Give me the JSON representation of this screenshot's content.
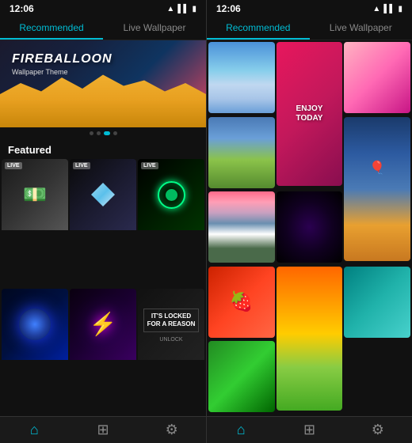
{
  "screens": [
    {
      "id": "left",
      "statusBar": {
        "time": "12:06",
        "icons": [
          "wifi",
          "signal",
          "battery"
        ]
      },
      "tabs": [
        {
          "id": "recommended",
          "label": "Recommended",
          "active": true
        },
        {
          "id": "live",
          "label": "Live Wallpaper",
          "active": false
        }
      ],
      "hero": {
        "title": "FIREBALLOON",
        "subtitle": "Wallpaper Theme"
      },
      "dots": [
        {
          "active": false
        },
        {
          "active": false
        },
        {
          "active": true
        },
        {
          "active": false
        }
      ],
      "sectionTitle": "Featured",
      "wallpapers": [
        {
          "id": "money",
          "type": "money",
          "hasLive": true
        },
        {
          "id": "diamond",
          "type": "diamond",
          "hasLive": true
        },
        {
          "id": "circle",
          "type": "circle",
          "hasLive": true
        },
        {
          "id": "smoke",
          "type": "smoke",
          "hasLive": false
        },
        {
          "id": "lightning",
          "type": "lightning",
          "hasLive": false
        },
        {
          "id": "locked",
          "type": "locked",
          "hasLive": false,
          "text": "IT'S LOCKED\nFOR A REASON"
        }
      ],
      "bottomNav": [
        {
          "id": "home",
          "icon": "⌂",
          "active": true
        },
        {
          "id": "apps",
          "icon": "⊞",
          "active": false
        },
        {
          "id": "settings",
          "icon": "⚙",
          "active": false
        }
      ],
      "liveBadge": "LIVE"
    }
  ],
  "rightScreen": {
    "statusBar": {
      "time": "12:06"
    },
    "tabs": [
      {
        "id": "recommended",
        "label": "Recommended",
        "active": true
      },
      {
        "id": "live",
        "label": "Live Wallpaper",
        "active": false
      }
    ],
    "gridItems": [
      {
        "id": "mountains",
        "class": "wg-mountains"
      },
      {
        "id": "enjoy",
        "class": "wg-enjoy",
        "tall": true,
        "overlayText": "ENJOY\nTODAY"
      },
      {
        "id": "cherry",
        "class": "wg-cherry"
      },
      {
        "id": "landscape-river",
        "class": "wg-landscape"
      },
      {
        "id": "balloons-sky",
        "class": "wg-balloons-sky",
        "tall": true
      },
      {
        "id": "mount-fuji",
        "class": "wg-mount-fuji"
      },
      {
        "id": "space",
        "class": "wg-space"
      },
      {
        "id": "strawberry",
        "class": "wg-strawberry"
      },
      {
        "id": "sunset",
        "class": "wg-sunset",
        "tall": true
      },
      {
        "id": "teal",
        "class": "wg-teal"
      }
    ],
    "bottomNav": [
      {
        "id": "home",
        "icon": "⌂",
        "active": true
      },
      {
        "id": "apps",
        "icon": "⊞",
        "active": false
      },
      {
        "id": "settings",
        "icon": "⚙",
        "active": false
      }
    ]
  }
}
